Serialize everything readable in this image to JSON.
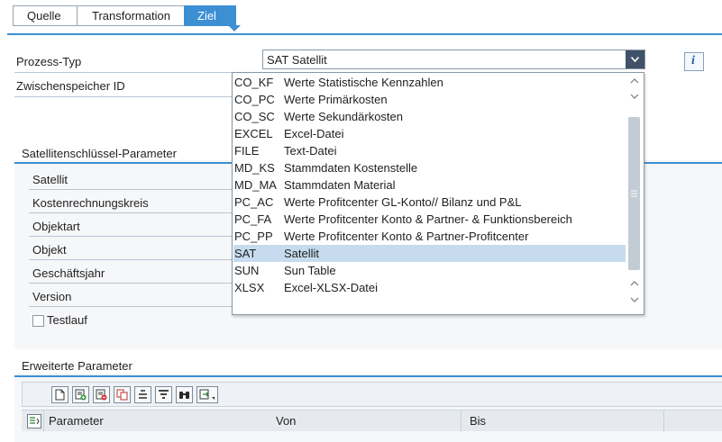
{
  "tabs": [
    {
      "label": "Quelle"
    },
    {
      "label": "Transformation"
    },
    {
      "label": "Ziel"
    }
  ],
  "form": {
    "prozess_typ_label": "Prozess-Typ",
    "prozess_typ_value": "SAT Satellit",
    "zwischenspeicher_label": "Zwischenspeicher ID",
    "info_icon": "info-icon"
  },
  "satellit_group": {
    "title": "Satellitenschlüssel-Parameter",
    "params": [
      {
        "label": "Satellit"
      },
      {
        "label": "Kostenrechnungskreis"
      },
      {
        "label": "Objektart"
      },
      {
        "label": "Objekt"
      },
      {
        "label": "Geschäftsjahr"
      },
      {
        "label": "Version"
      }
    ],
    "testlauf_label": "Testlauf",
    "testlauf_checked": false
  },
  "erweitert_group": {
    "title": "Erweiterte Parameter",
    "toolbar_icons": [
      "new-document-icon",
      "add-row-icon",
      "delete-row-icon",
      "copy-row-icon",
      "align-icon",
      "filter-icon",
      "find-icon",
      "export-icon"
    ],
    "columns": [
      "Parameter",
      "Von",
      "Bis"
    ]
  },
  "dropdown": {
    "options": [
      {
        "code": "CO_KF",
        "desc": "Werte Statistische Kennzahlen"
      },
      {
        "code": "CO_PC",
        "desc": "Werte Primärkosten"
      },
      {
        "code": "CO_SC",
        "desc": "Werte Sekundärkosten"
      },
      {
        "code": "EXCEL",
        "desc": "Excel-Datei"
      },
      {
        "code": "FILE",
        "desc": "Text-Datei"
      },
      {
        "code": "MD_KS",
        "desc": "Stammdaten Kostenstelle"
      },
      {
        "code": "MD_MA",
        "desc": "Stammdaten Material"
      },
      {
        "code": "PC_AC",
        "desc": "Werte Profitcenter GL-Konto// Bilanz und P&L"
      },
      {
        "code": "PC_FA",
        "desc": "Werte Profitcenter Konto & Partner- & Funktionsbereich"
      },
      {
        "code": "PC_PP",
        "desc": "Werte Profitcenter Konto & Partner-Profitcenter"
      },
      {
        "code": "SAT",
        "desc": "Satellit"
      },
      {
        "code": "SUN",
        "desc": "Sun Table"
      },
      {
        "code": "XLSX",
        "desc": "Excel-XLSX-Datei"
      }
    ],
    "selected_code": "SAT"
  },
  "colors": {
    "accent": "#3d8fd4",
    "selection": "#c6dcee"
  }
}
